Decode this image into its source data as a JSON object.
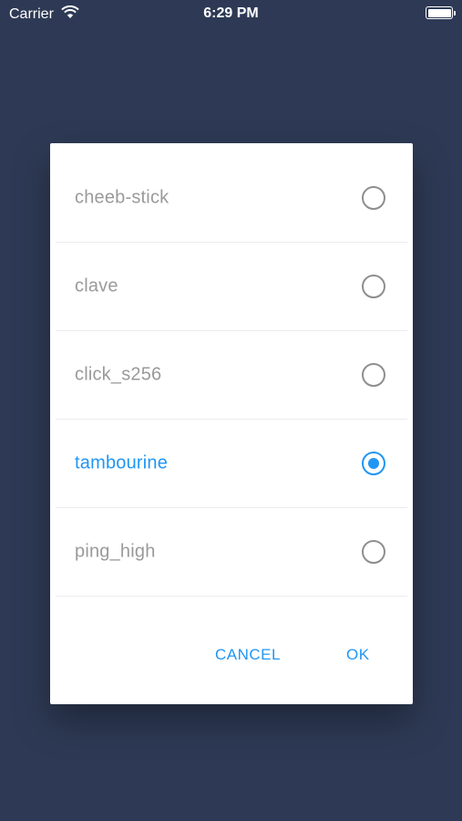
{
  "status_bar": {
    "carrier": "Carrier",
    "time": "6:29 PM",
    "wifi_icon": "wifi-icon",
    "battery_icon": "battery-icon"
  },
  "dialog": {
    "options": [
      {
        "label": "cheeb-stick",
        "selected": false
      },
      {
        "label": "clave",
        "selected": false
      },
      {
        "label": "click_s256",
        "selected": false
      },
      {
        "label": "tambourine",
        "selected": true
      },
      {
        "label": "ping_high",
        "selected": false
      }
    ],
    "cancel_label": "CANCEL",
    "ok_label": "OK"
  },
  "colors": {
    "background": "#2e3a55",
    "accent": "#2196f3",
    "unselected_text": "#9a9a9a"
  }
}
